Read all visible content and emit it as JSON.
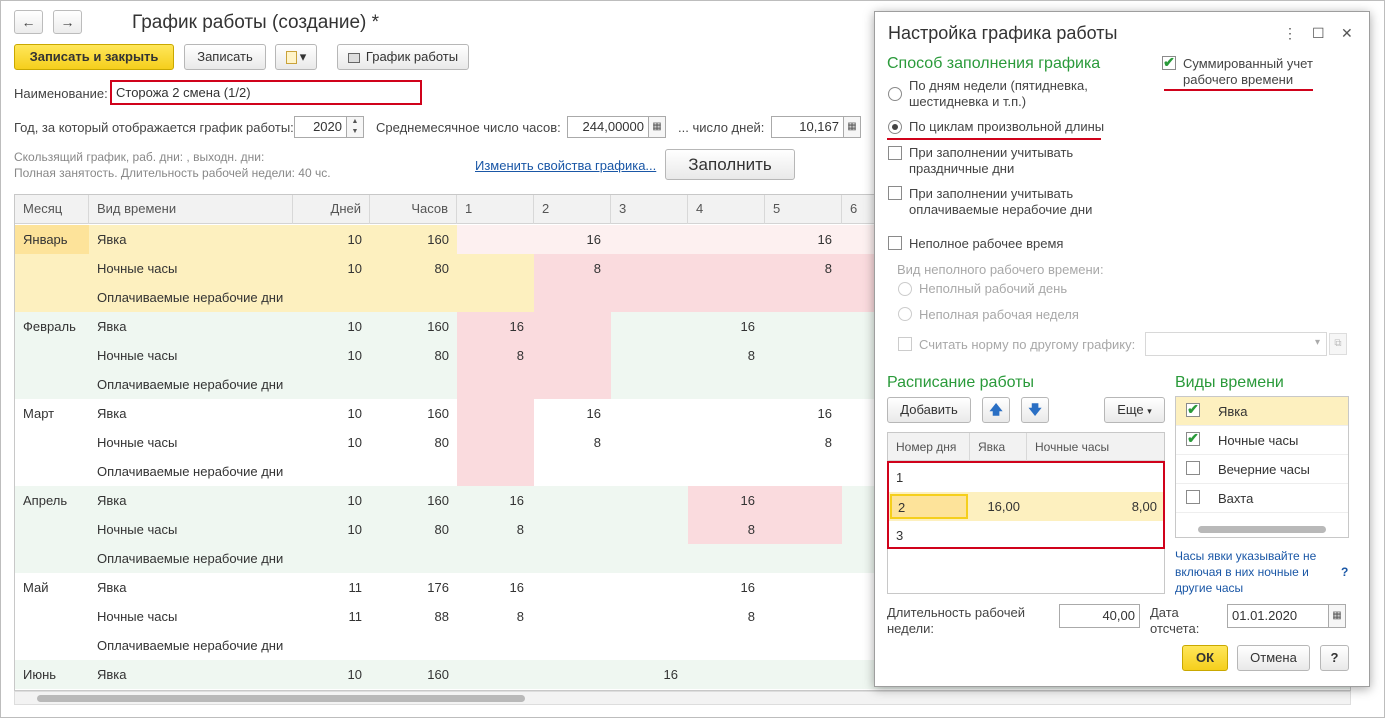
{
  "window": {
    "back": "←",
    "forward": "→",
    "title": "График работы (создание) *"
  },
  "toolbar": {
    "save_close": "Записать и закрыть",
    "save": "Записать",
    "print_menu": "▾",
    "schedule": "График работы"
  },
  "form": {
    "name_label": "Наименование:",
    "name_value": "Сторожа 2 смена (1/2)",
    "year_label": "Год, за который отображается график работы:",
    "year_value": "2020",
    "avg_hours_label": "Среднемесячное число часов:",
    "avg_hours_value": "244,00000",
    "avg_days_label": "... число дней:",
    "avg_days_value": "10,167",
    "info_line1": "Скользящий график, раб. дни: , выходн. дни:",
    "info_line2": "Полная занятость. Длительность рабочей недели: 40 чс.",
    "change_link": "Изменить свойства графика...",
    "fill_button": "Заполнить"
  },
  "grid": {
    "headers": [
      "Месяц",
      "Вид времени",
      "Дней",
      "Часов",
      "1",
      "2",
      "3",
      "4",
      "5",
      "6"
    ],
    "rows": [
      {
        "month": "Январь",
        "kind": "Явка",
        "days": "10",
        "hours": "160",
        "d": [
          "",
          "16",
          "",
          "",
          "16",
          ""
        ]
      },
      {
        "month": "",
        "kind": "Ночные часы",
        "days": "10",
        "hours": "80",
        "d": [
          "",
          "8",
          "",
          "",
          "8",
          ""
        ]
      },
      {
        "month": "",
        "kind": "Оплачиваемые нерабочие дни",
        "days": "",
        "hours": "",
        "d": [
          "",
          "",
          "",
          "",
          "",
          ""
        ]
      },
      {
        "month": "Февраль",
        "kind": "Явка",
        "days": "10",
        "hours": "160",
        "d": [
          "16",
          "",
          "",
          "16",
          "",
          ""
        ]
      },
      {
        "month": "",
        "kind": "Ночные часы",
        "days": "10",
        "hours": "80",
        "d": [
          "8",
          "",
          "",
          "8",
          "",
          ""
        ]
      },
      {
        "month": "",
        "kind": "Оплачиваемые нерабочие дни",
        "days": "",
        "hours": "",
        "d": [
          "",
          "",
          "",
          "",
          "",
          ""
        ]
      },
      {
        "month": "Март",
        "kind": "Явка",
        "days": "10",
        "hours": "160",
        "d": [
          "",
          "16",
          "",
          "",
          "16",
          ""
        ]
      },
      {
        "month": "",
        "kind": "Ночные часы",
        "days": "10",
        "hours": "80",
        "d": [
          "",
          "8",
          "",
          "",
          "8",
          ""
        ]
      },
      {
        "month": "",
        "kind": "Оплачиваемые нерабочие дни",
        "days": "",
        "hours": "",
        "d": [
          "",
          "",
          "",
          "",
          "",
          ""
        ]
      },
      {
        "month": "Апрель",
        "kind": "Явка",
        "days": "10",
        "hours": "160",
        "d": [
          "16",
          "",
          "",
          "16",
          "",
          ""
        ]
      },
      {
        "month": "",
        "kind": "Ночные часы",
        "days": "10",
        "hours": "80",
        "d": [
          "8",
          "",
          "",
          "8",
          "",
          ""
        ]
      },
      {
        "month": "",
        "kind": "Оплачиваемые нерабочие дни",
        "days": "",
        "hours": "",
        "d": [
          "",
          "",
          "",
          "",
          "",
          ""
        ]
      },
      {
        "month": "Май",
        "kind": "Явка",
        "days": "11",
        "hours": "176",
        "d": [
          "16",
          "",
          "",
          "16",
          "",
          ""
        ]
      },
      {
        "month": "",
        "kind": "Ночные часы",
        "days": "11",
        "hours": "88",
        "d": [
          "8",
          "",
          "",
          "8",
          "",
          ""
        ]
      },
      {
        "month": "",
        "kind": "Оплачиваемые нерабочие дни",
        "days": "",
        "hours": "",
        "d": [
          "",
          "",
          "",
          "",
          "",
          ""
        ]
      },
      {
        "month": "Июнь",
        "kind": "Явка",
        "days": "10",
        "hours": "160",
        "d": [
          "",
          "",
          "16",
          "",
          "",
          ""
        ]
      }
    ]
  },
  "dialog": {
    "title": "Настройка графика работы",
    "more": "⋮",
    "maximize": "☐",
    "close": "✕",
    "fill_method_title": "Способ заполнения графика",
    "opt_weekdays": "По дням недели (пятидневка, шестидневка и т.п.)",
    "opt_cycles": "По циклам произвольной длины",
    "chk_holidays": "При заполнении учитывать праздничные дни",
    "chk_paid_nonwork": "При заполнении учитывать оплачиваемые нерабочие дни",
    "chk_summarized": "Суммированный учет рабочего времени",
    "chk_parttime": "Неполное рабочее время",
    "parttime_kind_label": "Вид неполного рабочего времени:",
    "opt_partday": "Неполный рабочий день",
    "opt_partweek": "Неполная рабочая неделя",
    "chk_other_norm": "Считать норму по другому графику:",
    "schedule_title": "Расписание работы",
    "add_button": "Добавить",
    "more_button": "Еще",
    "sched_headers": [
      "Номер дня",
      "Явка",
      "Ночные часы"
    ],
    "sched_rows": [
      {
        "num": "1",
        "work": "",
        "night": ""
      },
      {
        "num": "2",
        "work": "16,00",
        "night": "8,00"
      },
      {
        "num": "3",
        "work": "",
        "night": ""
      }
    ],
    "kinds_title": "Виды времени",
    "kinds": [
      {
        "label": "Явка",
        "checked": "✔"
      },
      {
        "label": "Ночные часы",
        "checked": "✔"
      },
      {
        "label": "Вечерние часы",
        "checked": ""
      },
      {
        "label": "Вахта",
        "checked": ""
      }
    ],
    "kinds_help": "Часы явки указывайте не включая в них ночные и другие часы",
    "help_mark": "?",
    "week_length_label": "Длительность рабочей недели:",
    "week_length_value": "40,00",
    "ref_date_label": "Дата отсчета:",
    "ref_date_value": "01.01.2020",
    "ok": "ОК",
    "cancel": "Отмена",
    "help": "?"
  },
  "colors": {
    "accent_yellow": "#f5cf1c",
    "pink_cell": "#fadbde",
    "green_row": "#eff7f1",
    "highlight_yellow": "#fdf0bf",
    "section_green": "#2a9a3a",
    "red_mark": "#d0021b"
  }
}
